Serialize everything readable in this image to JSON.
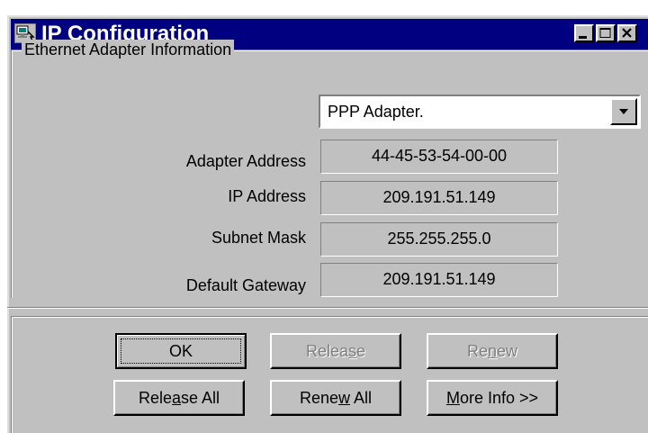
{
  "window": {
    "title": "IP Configuration",
    "icon": "network-config-icon",
    "controls": [
      "minimize-icon",
      "maximize-icon",
      "close-icon"
    ]
  },
  "adapter_group": {
    "legend": "Ethernet  Adapter Information",
    "adapter_select": {
      "selected": "PPP Adapter."
    },
    "fields": [
      {
        "label": "Adapter Address",
        "value": "44-45-53-54-00-00"
      },
      {
        "label": "IP Address",
        "value": "209.191.51.149"
      },
      {
        "label": "Subnet Mask",
        "value": "255.255.255.0"
      },
      {
        "label": "Default Gateway",
        "value": "209.191.51.149"
      }
    ]
  },
  "buttons": {
    "ok": {
      "pre": "OK",
      "key": "",
      "post": "",
      "enabled": true,
      "default": true
    },
    "release": {
      "pre": "Relea",
      "key": "s",
      "post": "e",
      "enabled": false
    },
    "renew": {
      "pre": "Re",
      "key": "n",
      "post": "ew",
      "enabled": false
    },
    "release_all": {
      "pre": "Rele",
      "key": "a",
      "post": "se All",
      "enabled": true
    },
    "renew_all": {
      "pre": "Rene",
      "key": "w",
      "post": " All",
      "enabled": true
    },
    "more_info": {
      "pre": "",
      "key": "M",
      "post": "ore Info >>",
      "enabled": true
    }
  },
  "colors": {
    "titlebar": "#000080",
    "face": "#c0c0c0",
    "disabled_text": "#808080"
  }
}
